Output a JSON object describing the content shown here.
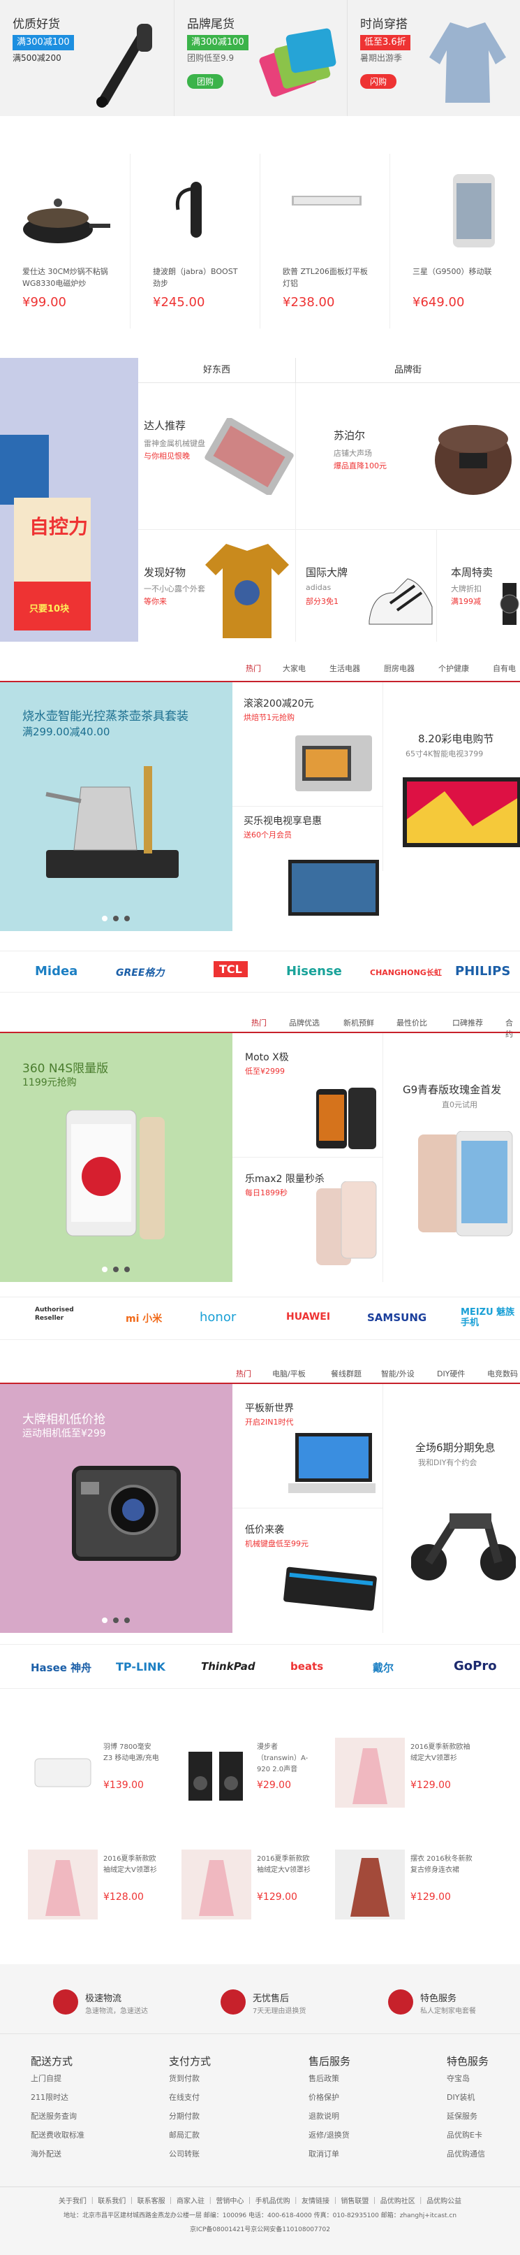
{
  "promo": [
    {
      "title": "优质好货",
      "tag1": "满300减100",
      "tag2": "满500减200"
    },
    {
      "title": "品牌尾货",
      "tag1": "满300减100",
      "sub": "团购低至9.9",
      "btn": "团购"
    },
    {
      "title": "时尚穿搭",
      "tag1": "低至3.6折",
      "sub": "暑期出游季",
      "btn": "闪购"
    }
  ],
  "products": [
    {
      "name": "爱仕达 30CM炒锅不粘锅WG8330电磁炉炒",
      "price": "¥99.00"
    },
    {
      "name": "捷波朗（jabra）BOOST劲步",
      "price": "¥245.00"
    },
    {
      "name": "欧普 ZTL206面板灯平板灯铝",
      "price": "¥238.00"
    },
    {
      "name": "三星（G9500）移动联",
      "price": "¥649.00"
    }
  ],
  "haodongxi": {
    "col1": "好东西",
    "col2": "品牌街",
    "books_title": "自控力",
    "books_promo": "只要10块",
    "items": [
      {
        "t": "达人推荐",
        "d1": "雷神金属机械键盘",
        "d2": "与你相见恨晚"
      },
      {
        "t": "苏泊尔",
        "d1": "店铺大声场",
        "d2": "爆品直降100元"
      },
      {
        "t": "发现好物",
        "d1": "一不小心露个外套",
        "d2": "等你来"
      },
      {
        "t": "国际大牌",
        "d1": "adidas",
        "d2": "部分3免1"
      },
      {
        "t": "本周特卖",
        "d1": "大牌折扣",
        "d2": "满199减"
      }
    ]
  },
  "sec1": {
    "tabs": [
      "热门",
      "大家电",
      "生活电器",
      "厨房电器",
      "个护健康",
      "自有电"
    ],
    "big_title": "烧水壶智能光控蒸茶壶茶具套装",
    "big_sub": "满299.00减40.00",
    "items": [
      {
        "t": "滚滚200减20元",
        "d": "烘焙节1元抢购"
      },
      {
        "t": "8.20彩电电购节",
        "d": "65寸4K智能电视3799"
      },
      {
        "t": "买乐视电视享皂惠",
        "d": "送60个月会员"
      }
    ],
    "brands": [
      "Midea",
      "GREE格力",
      "TCL",
      "Hisense",
      "CHANGHONG长虹",
      "PHILIPS"
    ]
  },
  "sec2": {
    "tabs": [
      "热门",
      "品牌优选",
      "新机预鲜",
      "最性价比",
      "口碑推荐",
      "合约"
    ],
    "big_title": "360 N4S限量版",
    "big_sub": "1199元抢购",
    "items": [
      {
        "t": "Moto X极",
        "d": "低至¥2999"
      },
      {
        "t": "G9青春版玫瑰金首发",
        "d": "直0元试用"
      },
      {
        "t": "乐max2 限量秒杀",
        "d": "每日1899秒"
      }
    ],
    "brands": [
      "Authorised Reseller",
      "mi 小米",
      "honor",
      "HUAWEI",
      "SAMSUNG",
      "MEIZU 魅族手机"
    ]
  },
  "sec3": {
    "tabs": [
      "热门",
      "电脑/平板",
      "餐线群题",
      "智能/外设",
      "DIY硬件",
      "电竞数码"
    ],
    "big_title": "大牌相机低价抢",
    "big_sub": "运动相机低至¥299",
    "items": [
      {
        "t": "平板新世界",
        "d": "开启2IN1时代"
      },
      {
        "t": "全场6期分期免息",
        "d": "我和DIY有个约会"
      },
      {
        "t": "低价来袭",
        "d": "机械键盘低至99元"
      }
    ],
    "brands": [
      "Hasee 神舟",
      "TP-LINK",
      "ThinkPad",
      "beats",
      "戴尔",
      "GoPro"
    ]
  },
  "grid": [
    {
      "name": "羽博 7800毫安 Z3 移动电源/充电",
      "price": "¥139.00"
    },
    {
      "name": "漫步者（transwin）A-920 2.0声音",
      "price": "¥29.00"
    },
    {
      "name": "2016夏季新款欧袖绒定大V领罩衫",
      "price": "¥129.00"
    },
    {
      "name": "2016夏季新款欧袖绒定大V领罩衫",
      "price": "¥128.00"
    },
    {
      "name": "2016夏季新款欧袖绒定大V领罩衫",
      "price": "¥129.00"
    },
    {
      "name": "摆衣 2016秋冬新款复古修身连衣裙",
      "price": "¥129.00"
    }
  ],
  "services": [
    {
      "t": "极速物流",
      "d": "急速物流，急速送达"
    },
    {
      "t": "无忧售后",
      "d": "7天无理由退换货"
    },
    {
      "t": "特色服务",
      "d": "私人定制家电套餐"
    }
  ],
  "footer_cols": [
    {
      "h": "配送方式",
      "l": [
        "上门自提",
        "211限时达",
        "配送服务查询",
        "配送费收取标准",
        "海外配送"
      ]
    },
    {
      "h": "支付方式",
      "l": [
        "货到付款",
        "在线支付",
        "分期付款",
        "邮局汇款",
        "公司转账"
      ]
    },
    {
      "h": "售后服务",
      "l": [
        "售后政策",
        "价格保护",
        "退款说明",
        "返修/退换货",
        "取消订单"
      ]
    },
    {
      "h": "特色服务",
      "l": [
        "夺宝岛",
        "DIY装机",
        "延保服务",
        "品优购E卡",
        "品优购通信"
      ]
    }
  ],
  "bottom_links": "关于我们 ｜ 联系我们 ｜ 联系客服 ｜ 商家入驻 ｜ 营销中心 ｜ 手机品优购 ｜ 友情链接 ｜ 销售联盟 ｜ 品优购社区 ｜ 品优购公益",
  "address": "地址：北京市昌平区建材城西路金燕龙办公楼一层 邮编：100096 电话：400-618-4000 传真：010-82935100 邮箱：zhanghj+itcast.cn",
  "icp": "京ICP备08001421号京公网安备110108007702",
  "colors": {
    "accent": "#c7212b",
    "price": "#e33"
  }
}
